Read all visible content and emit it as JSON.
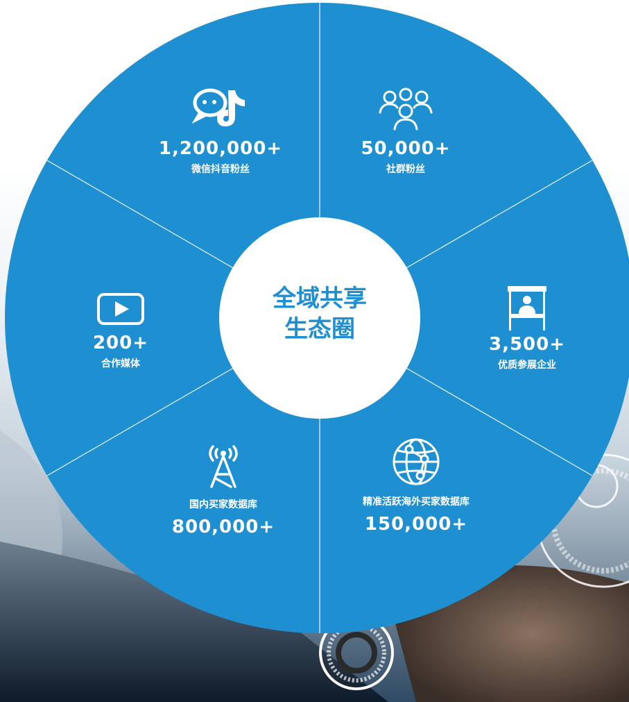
{
  "center": {
    "line1": "全域共享",
    "line2": "生态圈"
  },
  "segments": [
    {
      "icon": "wechat-douyin-icon",
      "value": "1,200,000+",
      "label": "微信抖音粉丝"
    },
    {
      "icon": "community-group-icon",
      "value": "50,000+",
      "label": "社群粉丝"
    },
    {
      "icon": "exhibition-booth-icon",
      "value": "3,500+",
      "label": "优质参展企业"
    },
    {
      "icon": "globe-network-icon",
      "label": "精准活跃海外买家数据库",
      "value": "150,000+"
    },
    {
      "icon": "broadcast-tower-icon",
      "label": "国内买家数据库",
      "value": "800,000+"
    },
    {
      "icon": "video-play-icon",
      "value": "200+",
      "label": "合作媒体"
    }
  ],
  "colors": {
    "wheel": "#1e8fd1",
    "center": "#ffffff",
    "text": "#ffffff"
  }
}
